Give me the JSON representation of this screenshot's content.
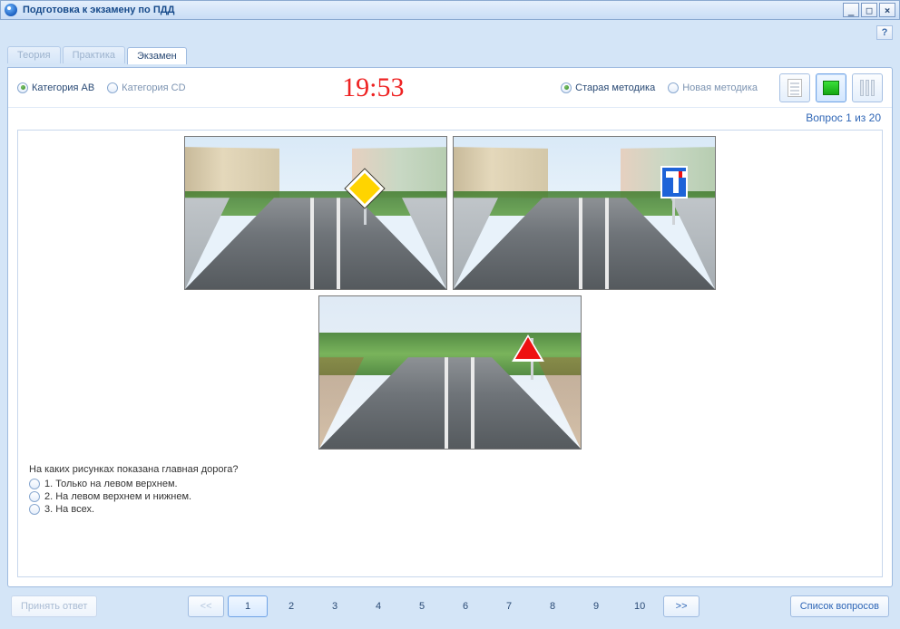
{
  "window": {
    "title": "Подготовка к экзамену по ПДД",
    "min": "_",
    "max": "□",
    "close": "×",
    "help": "?"
  },
  "tabs": [
    {
      "label": "Теория",
      "active": false
    },
    {
      "label": "Практика",
      "active": false
    },
    {
      "label": "Экзамен",
      "active": true
    }
  ],
  "category": {
    "ab": "Категория AB",
    "cd": "Категория CD",
    "selected": "ab"
  },
  "timer": "19:53",
  "method": {
    "old": "Старая методика",
    "new": "Новая методика",
    "selected": "old"
  },
  "counter": "Вопрос 1 из 20",
  "question": {
    "text": "На каких рисунках показана главная дорога?",
    "answers": [
      "1. Только на левом верхнем.",
      "2. На левом верхнем и нижнем.",
      "3. На всех."
    ]
  },
  "buttons": {
    "accept": "Принять ответ",
    "prev": "<<",
    "next": ">>",
    "list": "Список вопросов"
  },
  "pages": [
    "1",
    "2",
    "3",
    "4",
    "5",
    "6",
    "7",
    "8",
    "9",
    "10"
  ],
  "current_page": "1"
}
